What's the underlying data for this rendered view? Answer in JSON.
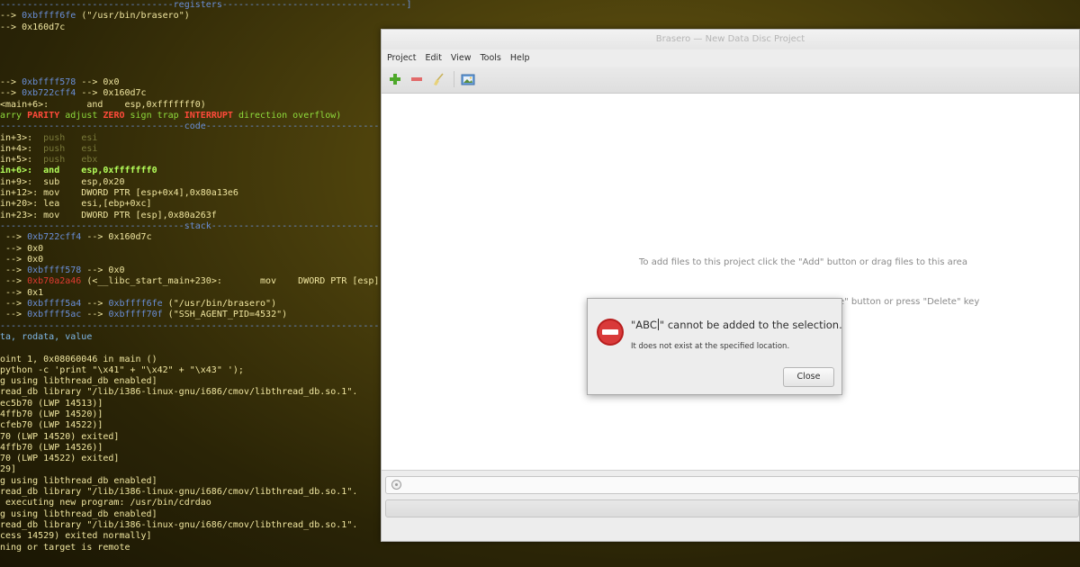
{
  "terminal": {
    "lines": [
      [
        {
          "t": "--------------------------------registers----------------------------------]",
          "c": "c-blue"
        }
      ],
      [
        {
          "t": "--> ",
          "c": "c-yellow"
        },
        {
          "t": "0xbffff6fe",
          "c": "c-blue"
        },
        {
          "t": " (\"/usr/bin/brasero\")",
          "c": "c-yellow"
        }
      ],
      [
        {
          "t": "--> 0x160d7c",
          "c": "c-yellow"
        }
      ],
      [],
      [],
      [],
      [],
      [
        {
          "t": "--> ",
          "c": "c-yellow"
        },
        {
          "t": "0xbffff578",
          "c": "c-blue"
        },
        {
          "t": " --> 0x0",
          "c": "c-yellow"
        }
      ],
      [
        {
          "t": "--> ",
          "c": "c-yellow"
        },
        {
          "t": "0xb722cff4",
          "c": "c-blue"
        },
        {
          "t": " --> 0x160d7c",
          "c": "c-yellow"
        }
      ],
      [
        {
          "t": "<main+6>:       and    esp,0xfffffff0)",
          "c": "c-yellow"
        }
      ],
      [
        {
          "t": "arry ",
          "c": "c-green"
        },
        {
          "t": "PARITY",
          "c": "c-red"
        },
        {
          "t": " adjust ",
          "c": "c-green"
        },
        {
          "t": "ZERO",
          "c": "c-red"
        },
        {
          "t": " sign trap ",
          "c": "c-green"
        },
        {
          "t": "INTERRUPT",
          "c": "c-red"
        },
        {
          "t": " direction overflow)",
          "c": "c-green"
        }
      ],
      [
        {
          "t": "----------------------------------code-------------------------------------]",
          "c": "c-blue"
        }
      ],
      [
        {
          "t": "in+3>:  ",
          "c": "c-yellow"
        },
        {
          "t": "push   esi",
          "c": "c-dim"
        }
      ],
      [
        {
          "t": "in+4>:  ",
          "c": "c-yellow"
        },
        {
          "t": "push   esi",
          "c": "c-dim"
        }
      ],
      [
        {
          "t": "in+5>:  ",
          "c": "c-yellow"
        },
        {
          "t": "push   ebx",
          "c": "c-dim"
        }
      ],
      [
        {
          "t": "in+6>:  and    esp,0xfffffff0",
          "c": "c-bgreen"
        }
      ],
      [
        {
          "t": "in+9>:  sub    esp,0x20",
          "c": "c-yellow"
        }
      ],
      [
        {
          "t": "in+12>: mov    DWORD PTR [esp+0x4],0x80a13e6",
          "c": "c-yellow"
        }
      ],
      [
        {
          "t": "in+20>: lea    esi,[ebp+0xc]",
          "c": "c-yellow"
        }
      ],
      [
        {
          "t": "in+23>: mov    DWORD PTR [esp],0x80a263f",
          "c": "c-yellow"
        }
      ],
      [
        {
          "t": "----------------------------------stack------------------------------------]",
          "c": "c-blue"
        }
      ],
      [
        {
          "t": " --> ",
          "c": "c-yellow"
        },
        {
          "t": "0xb722cff4",
          "c": "c-blue"
        },
        {
          "t": " --> 0x160d7c",
          "c": "c-yellow"
        }
      ],
      [
        {
          "t": " --> 0x0",
          "c": "c-yellow"
        }
      ],
      [
        {
          "t": " --> 0x0",
          "c": "c-yellow"
        }
      ],
      [
        {
          "t": " --> ",
          "c": "c-yellow"
        },
        {
          "t": "0xbffff578",
          "c": "c-blue"
        },
        {
          "t": " --> 0x0",
          "c": "c-yellow"
        }
      ],
      [
        {
          "t": " --> ",
          "c": "c-yellow"
        },
        {
          "t": "0xb70a2a46",
          "c": "c-redn"
        },
        {
          "t": " (<__libc_start_main+230>:       mov    DWORD PTR [esp]",
          "c": "c-yellow"
        }
      ],
      [
        {
          "t": " --> 0x1",
          "c": "c-yellow"
        }
      ],
      [
        {
          "t": " --> ",
          "c": "c-yellow"
        },
        {
          "t": "0xbffff5a4",
          "c": "c-blue"
        },
        {
          "t": " --> ",
          "c": "c-yellow"
        },
        {
          "t": "0xbffff6fe",
          "c": "c-blue"
        },
        {
          "t": " (\"/usr/bin/brasero\")",
          "c": "c-yellow"
        }
      ],
      [
        {
          "t": " --> ",
          "c": "c-yellow"
        },
        {
          "t": "0xbffff5ac",
          "c": "c-blue"
        },
        {
          "t": " --> ",
          "c": "c-yellow"
        },
        {
          "t": "0xbffff70f",
          "c": "c-blue"
        },
        {
          "t": " (\"SSH_AGENT_PID=4532\")",
          "c": "c-yellow"
        }
      ],
      [
        {
          "t": "---------------------------------------------------------------------------]",
          "c": "c-blue"
        }
      ],
      [
        {
          "t": "ta, rodata, value",
          "c": "c-cyan"
        }
      ],
      [],
      [
        {
          "t": "oint 1, 0x08060046 in main ()",
          "c": "c-yellow"
        }
      ],
      [
        {
          "t": "python -c 'print \"\\x41\" + \"\\x42\" + \"\\x43\" ');",
          "c": "c-yellow"
        }
      ],
      [
        {
          "t": "g using libthread_db enabled]",
          "c": "c-yellow"
        }
      ],
      [
        {
          "t": "read_db library \"/lib/i386-linux-gnu/i686/cmov/libthread_db.so.1\".",
          "c": "c-yellow"
        }
      ],
      [
        {
          "t": "ec5b70 (LWP 14513)]",
          "c": "c-yellow"
        }
      ],
      [
        {
          "t": "4ffb70 (LWP 14520)]",
          "c": "c-yellow"
        }
      ],
      [
        {
          "t": "cfeb70 (LWP 14522)]",
          "c": "c-yellow"
        }
      ],
      [
        {
          "t": "70 (LWP 14520) exited]",
          "c": "c-yellow"
        }
      ],
      [
        {
          "t": "4ffb70 (LWP 14526)]",
          "c": "c-yellow"
        }
      ],
      [
        {
          "t": "70 (LWP 14522) exited]",
          "c": "c-yellow"
        }
      ],
      [
        {
          "t": "29]",
          "c": "c-yellow"
        }
      ],
      [
        {
          "t": "g using libthread_db enabled]",
          "c": "c-yellow"
        }
      ],
      [
        {
          "t": "read_db library \"/lib/i386-linux-gnu/i686/cmov/libthread_db.so.1\".",
          "c": "c-yellow"
        }
      ],
      [
        {
          "t": " executing new program: /usr/bin/cdrdao",
          "c": "c-yellow"
        }
      ],
      [
        {
          "t": "g using libthread_db enabled]",
          "c": "c-yellow"
        }
      ],
      [
        {
          "t": "read_db library \"/lib/i386-linux-gnu/i686/cmov/libthread_db.so.1\".",
          "c": "c-yellow"
        }
      ],
      [
        {
          "t": "cess 14529) exited normally]",
          "c": "c-yellow"
        }
      ],
      [
        {
          "t": "ning or target is remote",
          "c": "c-yellow"
        }
      ]
    ]
  },
  "window": {
    "title": "Brasero — New Data Disc Project",
    "menu": [
      "Project",
      "Edit",
      "View",
      "Tools",
      "Help"
    ],
    "toolbar": {
      "add_icon": "plus-icon",
      "remove_icon": "minus-icon",
      "clear_icon": "broom-icon",
      "import_icon": "image-folder-icon"
    },
    "hint_add": "To add files to this project click the \"Add\" button or drag files to this area",
    "hint_remove_tail": "e\" button or press \"Delete\" key"
  },
  "dialog": {
    "icon": "error-icon",
    "primary_open": "\"ABC",
    "primary_rest": "\" cannot be added to the selection.",
    "secondary": "It does not exist at the specified location.",
    "close_label": "Close"
  },
  "colors": {
    "terminal_text": "#f0e6a0",
    "terminal_blue": "#6a8fd8",
    "terminal_red": "#ff4a3a",
    "error_red": "#d42a2a"
  }
}
